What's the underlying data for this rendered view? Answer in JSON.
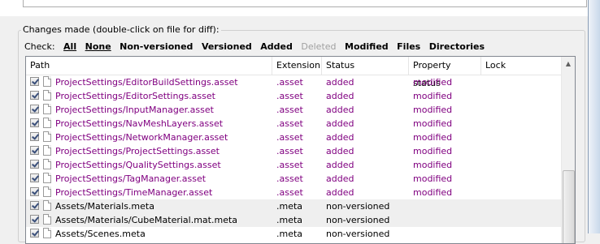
{
  "group_label": "Changes made (double-click on file for diff):",
  "check_label": "Check:",
  "check_links": [
    {
      "label": "All",
      "underline": true,
      "disabled": false
    },
    {
      "label": "None",
      "underline": true,
      "disabled": false
    },
    {
      "label": "Non-versioned",
      "underline": false,
      "disabled": false
    },
    {
      "label": "Versioned",
      "underline": false,
      "disabled": false
    },
    {
      "label": "Added",
      "underline": false,
      "disabled": false
    },
    {
      "label": "Deleted",
      "underline": false,
      "disabled": true
    },
    {
      "label": "Modified",
      "underline": false,
      "disabled": false
    },
    {
      "label": "Files",
      "underline": false,
      "disabled": false
    },
    {
      "label": "Directories",
      "underline": false,
      "disabled": false
    }
  ],
  "columns": [
    "Path",
    "Extension",
    "Status",
    "Property status",
    "Lock"
  ],
  "rows": [
    {
      "path": "ProjectSettings/EditorBuildSettings.asset",
      "ext": ".asset",
      "status": "added",
      "prop": "modified",
      "lock": "",
      "color": "#800080",
      "alt": false
    },
    {
      "path": "ProjectSettings/EditorSettings.asset",
      "ext": ".asset",
      "status": "added",
      "prop": "modified",
      "lock": "",
      "color": "#800080",
      "alt": false
    },
    {
      "path": "ProjectSettings/InputManager.asset",
      "ext": ".asset",
      "status": "added",
      "prop": "modified",
      "lock": "",
      "color": "#800080",
      "alt": false
    },
    {
      "path": "ProjectSettings/NavMeshLayers.asset",
      "ext": ".asset",
      "status": "added",
      "prop": "modified",
      "lock": "",
      "color": "#800080",
      "alt": false
    },
    {
      "path": "ProjectSettings/NetworkManager.asset",
      "ext": ".asset",
      "status": "added",
      "prop": "modified",
      "lock": "",
      "color": "#800080",
      "alt": false
    },
    {
      "path": "ProjectSettings/ProjectSettings.asset",
      "ext": ".asset",
      "status": "added",
      "prop": "modified",
      "lock": "",
      "color": "#800080",
      "alt": false
    },
    {
      "path": "ProjectSettings/QualitySettings.asset",
      "ext": ".asset",
      "status": "added",
      "prop": "modified",
      "lock": "",
      "color": "#800080",
      "alt": false
    },
    {
      "path": "ProjectSettings/TagManager.asset",
      "ext": ".asset",
      "status": "added",
      "prop": "modified",
      "lock": "",
      "color": "#800080",
      "alt": false
    },
    {
      "path": "ProjectSettings/TimeManager.asset",
      "ext": ".asset",
      "status": "added",
      "prop": "modified",
      "lock": "",
      "color": "#800080",
      "alt": false
    },
    {
      "path": "Assets/Materials.meta",
      "ext": ".meta",
      "status": "non-versioned",
      "prop": "",
      "lock": "",
      "color": "#000000",
      "alt": true
    },
    {
      "path": "Assets/Materials/CubeMaterial.mat.meta",
      "ext": ".meta",
      "status": "non-versioned",
      "prop": "",
      "lock": "",
      "color": "#000000",
      "alt": true
    },
    {
      "path": "Assets/Scenes.meta",
      "ext": ".meta",
      "status": "non-versioned",
      "prop": "",
      "lock": "",
      "color": "#000000",
      "alt": false
    }
  ]
}
